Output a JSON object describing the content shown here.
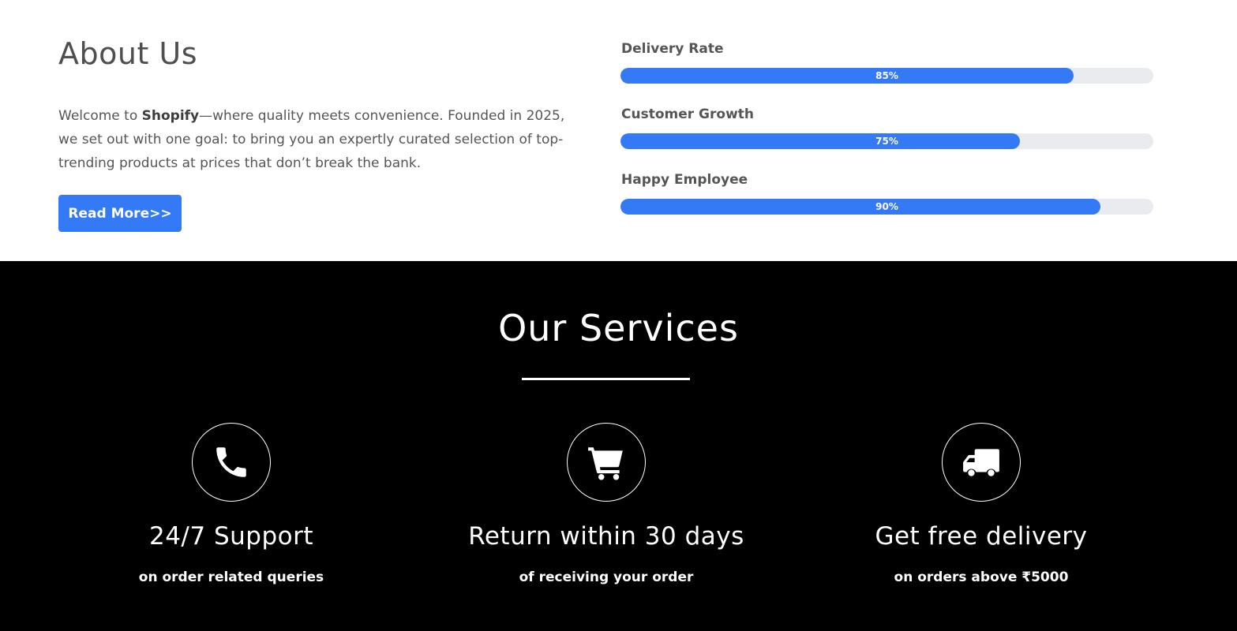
{
  "about": {
    "title": "About Us",
    "text_pre": "Welcome to ",
    "brand": "Shopify",
    "text_post": "—where quality meets convenience. Founded in 2025, we set out with one goal: to bring you an expertly curated selection of top-trending products at prices that don’t break the bank.",
    "button_label": "Read More>>"
  },
  "skills": [
    {
      "label": "Delivery Rate",
      "percent_text": "85%",
      "value": 85
    },
    {
      "label": "Customer Growth",
      "percent_text": "75%",
      "value": 75
    },
    {
      "label": "Happy Employee",
      "percent_text": "90%",
      "value": 90
    }
  ],
  "services": {
    "title": "Our Services",
    "items": [
      {
        "icon": "phone-icon",
        "title": "24/7 Support",
        "subtitle": "on order related queries"
      },
      {
        "icon": "cart-icon",
        "title": "Return within 30 days",
        "subtitle": "of receiving your order"
      },
      {
        "icon": "truck-icon",
        "title": "Get free delivery",
        "subtitle": "on orders above ₹5000"
      }
    ]
  },
  "colors": {
    "accent": "#3479f6",
    "track": "#e9ebef",
    "services_bg": "#000000"
  }
}
